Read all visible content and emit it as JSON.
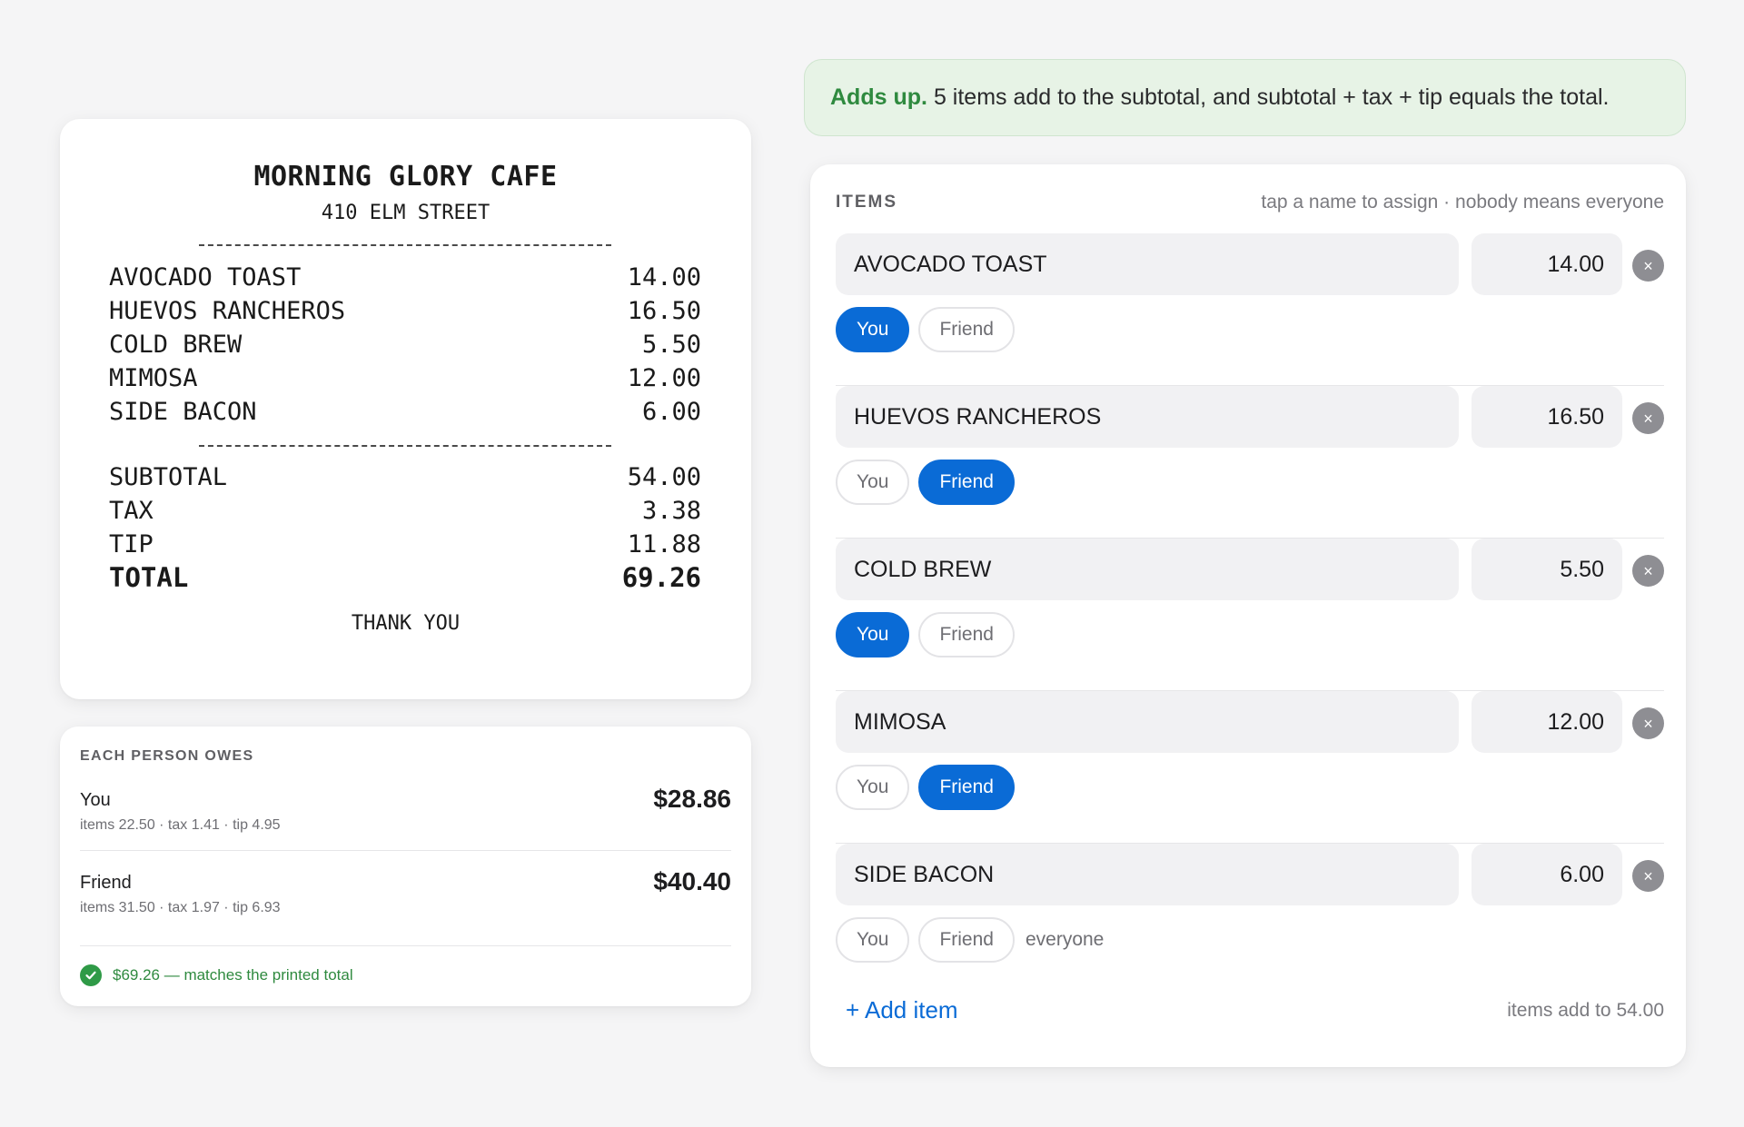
{
  "receipt": {
    "title": "MORNING GLORY CAFE",
    "address": "410 ELM STREET",
    "items": [
      {
        "name": "AVOCADO TOAST",
        "price": "14.00"
      },
      {
        "name": "HUEVOS RANCHEROS",
        "price": "16.50"
      },
      {
        "name": "COLD BREW",
        "price": "5.50"
      },
      {
        "name": "MIMOSA",
        "price": "12.00"
      },
      {
        "name": "SIDE BACON",
        "price": "6.00"
      }
    ],
    "subtotal_label": "SUBTOTAL",
    "subtotal": "54.00",
    "tax_label": "TAX",
    "tax": "3.38",
    "tip_label": "TIP",
    "tip": "11.88",
    "total_label": "TOTAL",
    "total": "69.26",
    "thanks": "THANK YOU"
  },
  "owes": {
    "header": "EACH PERSON OWES",
    "people": [
      {
        "name": "You",
        "amount": "$28.86",
        "detail": "items 22.50 · tax 1.41 · tip 4.95"
      },
      {
        "name": "Friend",
        "amount": "$40.40",
        "detail": "items 31.50 · tax 1.97 · tip 6.93"
      }
    ],
    "check_text": "$69.26 — matches the printed total",
    "check_icon": "check-circle-icon",
    "check_color": "#2f9a47"
  },
  "banner": {
    "strong": "Adds up.",
    "text": "5 items add to the subtotal, and subtotal + tax + tip equals the total."
  },
  "items_panel": {
    "header": "ITEMS",
    "hint": "tap a name to assign · nobody means everyone",
    "you_label": "You",
    "friend_label": "Friend",
    "everyone_label": "everyone",
    "remove_icon": "close-icon",
    "items": [
      {
        "name": "AVOCADO TOAST",
        "price": "14.00",
        "assigned": "You"
      },
      {
        "name": "HUEVOS RANCHEROS",
        "price": "16.50",
        "assigned": "Friend"
      },
      {
        "name": "COLD BREW",
        "price": "5.50",
        "assigned": "You"
      },
      {
        "name": "MIMOSA",
        "price": "12.00",
        "assigned": "Friend"
      },
      {
        "name": "SIDE BACON",
        "price": "6.00",
        "assigned": "everyone"
      }
    ],
    "add_item": "+ Add item",
    "items_total": "items add to 54.00",
    "accent": "#0a6bd6"
  }
}
